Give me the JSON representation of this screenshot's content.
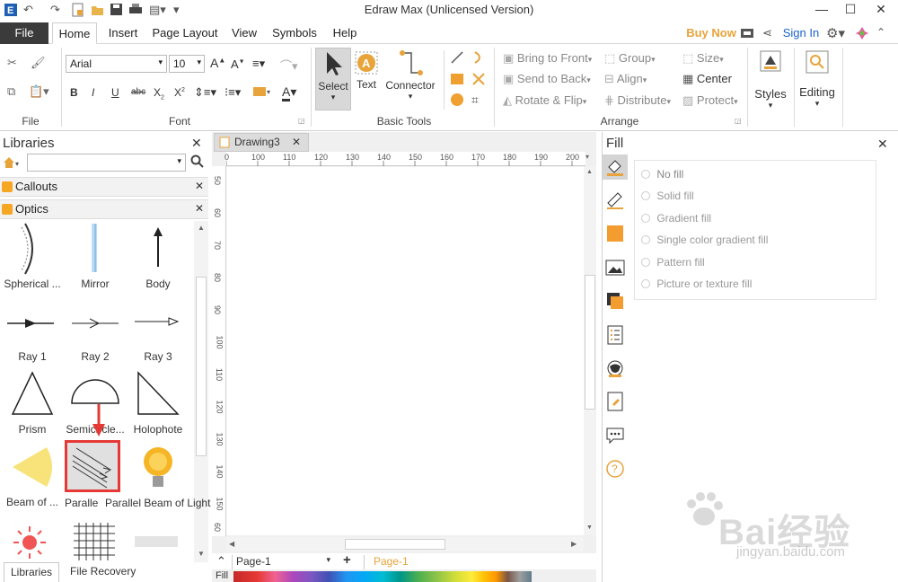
{
  "app": {
    "title": "Edraw Max (Unlicensed Version)"
  },
  "window": {
    "minimize": "—",
    "maximize": "☐",
    "close": "✕"
  },
  "menu": {
    "file": "File",
    "tabs": [
      "Home",
      "Insert",
      "Page Layout",
      "View",
      "Symbols",
      "Help"
    ],
    "buy_now": "Buy Now",
    "sign_in": "Sign In"
  },
  "ribbon": {
    "font_name": "Arial",
    "font_size": "10",
    "groups": {
      "file": "File",
      "font": "Font",
      "basic_tools": "Basic Tools",
      "arrange": "Arrange"
    },
    "select": "Select",
    "text": "Text",
    "connector": "Connector",
    "arrange_items": {
      "bring_to_front": "Bring to Front",
      "send_to_back": "Send to Back",
      "rotate_flip": "Rotate & Flip",
      "group": "Group",
      "align": "Align",
      "distribute": "Distribute",
      "size": "Size",
      "center": "Center",
      "protect": "Protect"
    },
    "styles": "Styles",
    "editing": "Editing"
  },
  "libraries": {
    "title": "Libraries",
    "search_value": "",
    "sections": [
      "Callouts",
      "Optics"
    ],
    "shapes": [
      {
        "label": "Spherical ..."
      },
      {
        "label": "Mirror"
      },
      {
        "label": "Body"
      },
      {
        "label": "Ray 1"
      },
      {
        "label": "Ray 2"
      },
      {
        "label": "Ray 3"
      },
      {
        "label": "Prism"
      },
      {
        "label": "Semicircle..."
      },
      {
        "label": "Holophote"
      },
      {
        "label": "Beam of ..."
      },
      {
        "label": "Paralle"
      },
      {
        "label": "Parallel Beam of Light"
      }
    ],
    "bottom_tabs": [
      "Libraries",
      "File Recovery"
    ]
  },
  "document": {
    "tab": "Drawing3",
    "ruler_top": [
      "0",
      "100",
      "110",
      "120",
      "130",
      "140",
      "150",
      "160",
      "170",
      "180",
      "190",
      "200"
    ],
    "ruler_left": [
      "50",
      "60",
      "70",
      "80",
      "90",
      "100",
      "110",
      "120",
      "130",
      "140",
      "150",
      "60"
    ],
    "page_select": "Page-1",
    "page_tab": "Page-1",
    "fill_label": "Fill"
  },
  "fill_panel": {
    "title": "Fill",
    "options": [
      "No fill",
      "Solid fill",
      "Gradient fill",
      "Single color gradient fill",
      "Pattern fill",
      "Picture or texture fill"
    ]
  },
  "watermark": {
    "text": "Bai经验",
    "url": "jingyan.baidu.com"
  },
  "colors": {
    "accent": "#e8a33b",
    "file_tab": "#3b3b3b",
    "highlight_box": "#e53935",
    "sign_in": "#1a62c9"
  }
}
